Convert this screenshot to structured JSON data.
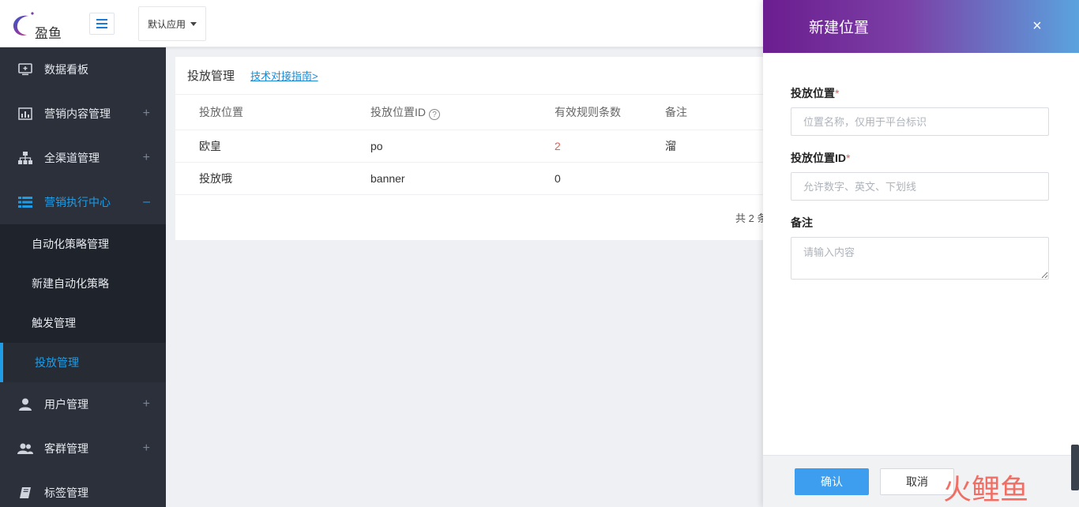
{
  "topbar": {
    "logo_text": "盈鱼",
    "app_select_label": "默认应用"
  },
  "sidebar": {
    "items": [
      {
        "label": "数据看板",
        "icon": "monitor-icon",
        "expand": ""
      },
      {
        "label": "营销内容管理",
        "icon": "bar-chart-icon",
        "expand": "+"
      },
      {
        "label": "全渠道管理",
        "icon": "sitemap-icon",
        "expand": "+"
      },
      {
        "label": "营销执行中心",
        "icon": "list-icon",
        "expand": "–"
      },
      {
        "label": "用户管理",
        "icon": "user-icon",
        "expand": "+"
      },
      {
        "label": "客群管理",
        "icon": "users-icon",
        "expand": "+"
      },
      {
        "label": "标签管理",
        "icon": "book-icon",
        "expand": ""
      }
    ],
    "submenu": [
      {
        "label": "自动化策略管理"
      },
      {
        "label": "新建自动化策略"
      },
      {
        "label": "触发管理"
      },
      {
        "label": "投放管理"
      }
    ]
  },
  "main": {
    "title": "投放管理",
    "guide_link": "技术对接指南>",
    "columns": [
      "投放位置",
      "投放位置ID",
      "有效规则条数",
      "备注"
    ],
    "rows": [
      {
        "position": "欧皇",
        "position_id": "po",
        "rule_count": "2",
        "note": "溜"
      },
      {
        "position": "投放哦",
        "position_id": "banner",
        "rule_count": "0",
        "note": ""
      }
    ],
    "pager_total": "共 2 条"
  },
  "drawer": {
    "title": "新建位置",
    "close_symbol": "×",
    "fields": {
      "position": {
        "label": "投放位置",
        "required_mark": "*",
        "placeholder": "位置名称，仅用于平台标识",
        "value": ""
      },
      "position_id": {
        "label": "投放位置ID",
        "required_mark": "*",
        "placeholder": "允许数字、英文、下划线",
        "value": ""
      },
      "note": {
        "label": "备注",
        "placeholder": "请输入内容",
        "value": ""
      }
    },
    "confirm_label": "确认",
    "cancel_label": "取消"
  },
  "watermark_text": "火鲤鱼",
  "colors": {
    "accent": "#1e9ce6",
    "primary_button": "#3d9ef0",
    "sidebar_bg": "#2b303b",
    "drawer_header_from": "#6b1d8f",
    "drawer_header_to": "#5aa3de",
    "danger": "#f0584c"
  }
}
